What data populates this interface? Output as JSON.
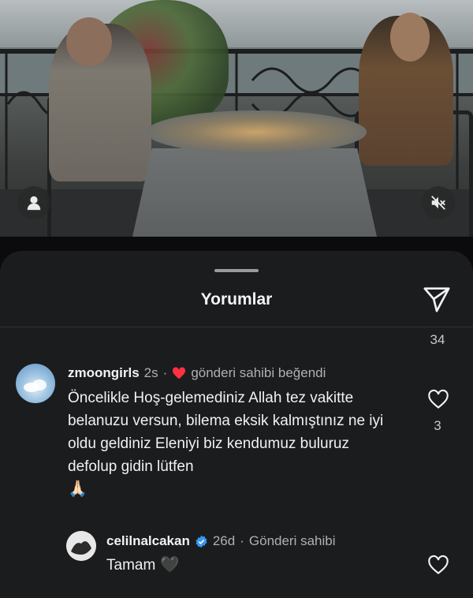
{
  "sheet": {
    "title": "Yorumlar"
  },
  "top_like_count": "34",
  "comments": [
    {
      "username": "zmoongirls",
      "time": "2s",
      "sep": "·",
      "liked_by_author_text": "gönderi sahibi beğendi",
      "text": "Öncelikle Hoş-gelemediniz Allah tez vakitte belanuzu versun, bilema eksik kalmıştınız ne iyi oldu geldiniz Eleniyi biz kendumuz buluruz defolup gidin lütfen",
      "emoji": "🙏🏻",
      "like_count": "3"
    },
    {
      "username": "celilnalcakan",
      "verified": true,
      "time": "26d",
      "sep": "·",
      "author_label": "Gönderi sahibi",
      "text": "Tamam",
      "emoji": "🖤"
    }
  ],
  "colors": {
    "heart_red": "#ff3040",
    "verified_blue": "#3897f0",
    "sheet_bg": "#1b1c1e"
  },
  "icons": [
    "user-icon",
    "mute-icon",
    "share-icon",
    "heart-icon",
    "verified-icon"
  ]
}
